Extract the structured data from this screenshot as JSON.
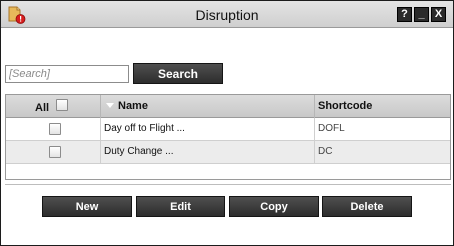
{
  "window": {
    "title": "Disruption",
    "controls": {
      "help": "?",
      "minimize": "_",
      "close": "X"
    }
  },
  "search": {
    "placeholder": "[Search]",
    "value": "",
    "button_label": "Search"
  },
  "grid": {
    "columns": {
      "all": "All",
      "name": "Name",
      "shortcode": "Shortcode"
    },
    "rows": [
      {
        "checked": false,
        "name": "Day off to Flight ...",
        "shortcode": "DOFL"
      },
      {
        "checked": false,
        "name": "Duty Change ...",
        "shortcode": "DC"
      }
    ]
  },
  "actions": {
    "new": "New",
    "edit": "Edit",
    "copy": "Copy",
    "delete": "Delete"
  },
  "colors": {
    "button_bg": "#3a3a3a",
    "header_bg": "#d2d2d2",
    "alt_row_bg": "#ececec",
    "icon_warning": "#d81e1e",
    "icon_doc": "#e7b95a"
  }
}
